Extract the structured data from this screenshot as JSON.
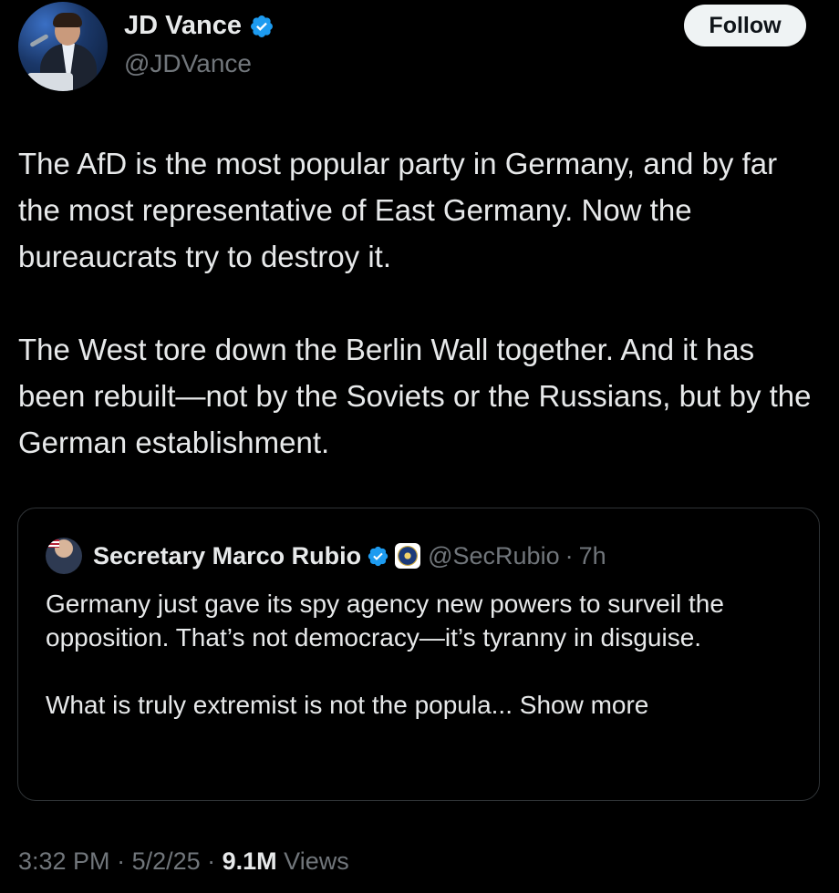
{
  "author": {
    "display_name": "JD Vance",
    "handle": "@JDVance",
    "verified": true
  },
  "follow_label": "Follow",
  "tweet": {
    "paragraphs": [
      "The AfD is the most popular party in Germany, and by far the most representative of East Germany. Now the bureaucrats try to destroy it.",
      "The West tore down the Berlin Wall together. And it has been rebuilt—not by the Soviets or the Russians, but by the German establishment."
    ]
  },
  "quote": {
    "display_name": "Secretary Marco Rubio",
    "handle": "@SecRubio",
    "separator": "·",
    "time": "7h",
    "paragraphs": [
      "Germany just gave its spy agency new powers to surveil the opposition.  That’s not democracy—it’s tyranny in disguise.",
      "What is truly extremist is not the popula... "
    ],
    "show_more": "Show more"
  },
  "meta": {
    "time": "3:32 PM",
    "sep1": " · ",
    "date": "5/2/25",
    "sep2": " · ",
    "views_count": "9.1M",
    "views_label": " Views"
  },
  "colors": {
    "background": "#000000",
    "text": "#e7e9ea",
    "secondary": "#71767b",
    "verified_badge": "#1d9bf0",
    "border": "#2f3336",
    "follow_bg": "#eff3f4"
  }
}
